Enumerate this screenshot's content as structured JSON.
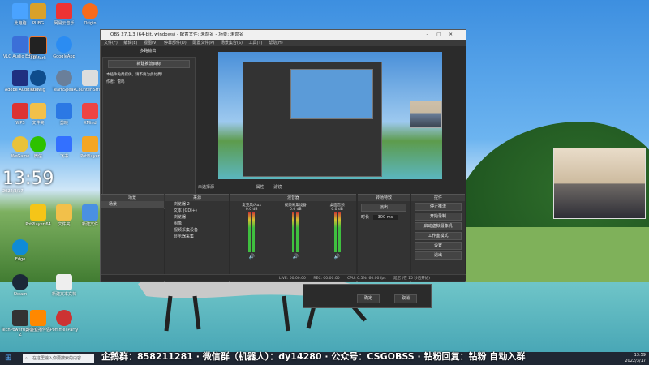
{
  "desktop": {
    "clock_time": "13:59",
    "clock_date": "2022/3/17",
    "icons": [
      {
        "label": "此电脑"
      },
      {
        "label": "PUBG"
      },
      {
        "label": "网易云音乐"
      },
      {
        "label": "Origin"
      },
      {
        "label": "VLC Audio Editor"
      },
      {
        "label": "3DMark"
      },
      {
        "label": "GoogleApp"
      },
      {
        "label": "Adobe Audition"
      },
      {
        "label": "Ludwig"
      },
      {
        "label": "TeamSpeak"
      },
      {
        "label": "Counter-Strike"
      },
      {
        "label": "WPS"
      },
      {
        "label": "文件夹"
      },
      {
        "label": "剪映"
      },
      {
        "label": "XMind"
      },
      {
        "label": "WeGame"
      },
      {
        "label": "微信"
      },
      {
        "label": "飞书"
      },
      {
        "label": "PotPlayer"
      },
      {
        "label": "PotPlayer 64"
      },
      {
        "label": "文件夹"
      },
      {
        "label": "新建文件"
      },
      {
        "label": "Edge"
      },
      {
        "label": "Steam"
      },
      {
        "label": "新建文本文档"
      },
      {
        "label": "TechPowerUp GPU-Z"
      },
      {
        "label": "斗鱼直播伴侣"
      },
      {
        "label": "Pommel Party"
      }
    ]
  },
  "obs": {
    "title": "OBS 27.1.3 (64-bit, windows) - 配置文件: 未命名 - 场景: 未命名",
    "menu": [
      "文件(F)",
      "编辑(E)",
      "视图(V)",
      "停靠部件(D)",
      "配置文件(P)",
      "场景集合(S)",
      "工具(T)",
      "帮助(H)"
    ],
    "left_dock_title": "多路输出",
    "left_dock_button": "新建推流目标",
    "left_dock_text_1": "本插件免费提供，请不要为此付费！",
    "left_dock_text_2": "作者：雷鸣",
    "preview_label": "未选择源",
    "preview_props": "属性",
    "preview_filters": "滤镜",
    "scenes_header": "场景",
    "scenes": [
      "场景"
    ],
    "sources_header": "来源",
    "sources": [
      "浏览器 2",
      "文本 (GDI+)",
      "浏览器",
      "图像",
      "视频采集设备",
      "显示器采集"
    ],
    "mixer_header": "混音器",
    "mixer_channels": [
      {
        "name": "麦克风/Aux",
        "level": "0.0 dB"
      },
      {
        "name": "视频采集设备",
        "level": "0.0 dB"
      },
      {
        "name": "桌面音频",
        "level": "0.0 dB"
      }
    ],
    "transition_header": "转场特效",
    "transition_type": "淡出",
    "transition_duration_label": "时长",
    "transition_duration": "300 ms",
    "controls_header": "控件",
    "controls": [
      "停止推流",
      "开始录制",
      "启动虚拟摄像机",
      "工作室模式",
      "设置",
      "退出"
    ],
    "status": {
      "live": "LIVE: 00:00:00",
      "rec": "REC: 00:00:00",
      "cpu": "CPU: 0.5%, 60.00 fps",
      "auto_start": "延迟 (在 15 秒后开始)"
    }
  },
  "dialog": {
    "ok": "确定",
    "cancel": "取消"
  },
  "taskbar": {
    "search_placeholder": "在这里输入你要搜索的内容",
    "time": "13:59",
    "date": "2022/3/17"
  },
  "ticker": "企鹅群：858211281 · 微信群（机器人）：dy14280 · 公众号：CSGOBSS · 钻粉回复：钻粉 自动入群"
}
